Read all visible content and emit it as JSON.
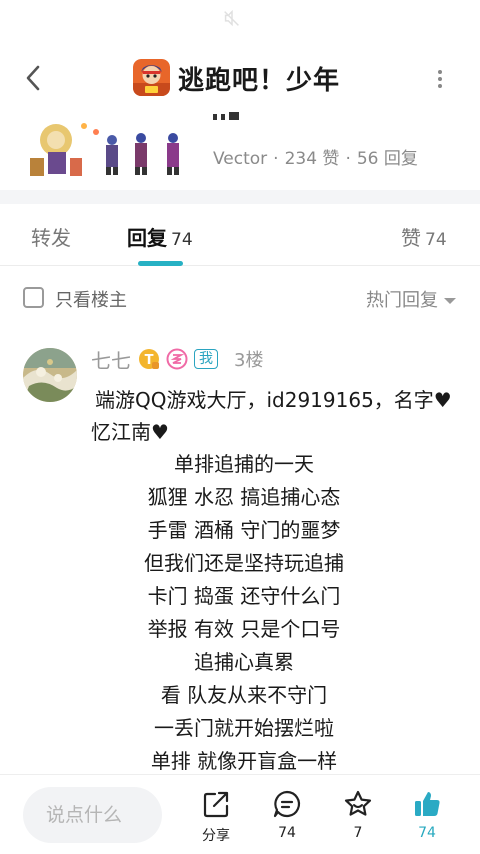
{
  "status_bar": {
    "icon": "mute-icon"
  },
  "nav": {
    "title": "逃跑吧！少年",
    "back_icon": "chevron-left-icon",
    "more_icon": "more-vertical-icon"
  },
  "post": {
    "author": "Vector",
    "likes": "234 赞",
    "replies": "56 回复"
  },
  "tabs": {
    "forward": {
      "label": "转发"
    },
    "reply": {
      "label": "回复",
      "count": "74"
    },
    "like": {
      "label": "赞",
      "count": "74"
    }
  },
  "filter": {
    "op_only_label": "只看楼主",
    "sort_label": "热门回复"
  },
  "reply": {
    "username": "七七",
    "me_tag": "我",
    "floor": "3楼",
    "paragraph_1": "端游QQ游戏大厅，id2919165，名字♥",
    "paragraph_2": "忆江南♥",
    "verses": [
      "单排追捕的一天",
      "狐狸 水忍 搞追捕心态",
      "手雷 酒桶 守门的噩梦",
      "但我们还是坚持玩追捕",
      "卡门 捣蛋 还守什么门",
      "举报 有效 只是个口号",
      "追捕心真累",
      "看 队友从来不守门",
      "一丢门就开始摆烂啦",
      "单排 就像开盲盒一样"
    ]
  },
  "bottom_bar": {
    "input_placeholder": "说点什么",
    "share_label": "分享",
    "comment_count": "74",
    "favorite_count": "7",
    "like_count": "74"
  },
  "colors": {
    "accent": "#27b1c4",
    "like_active": "#2aaac4",
    "muted_text": "#8a8a8a"
  }
}
